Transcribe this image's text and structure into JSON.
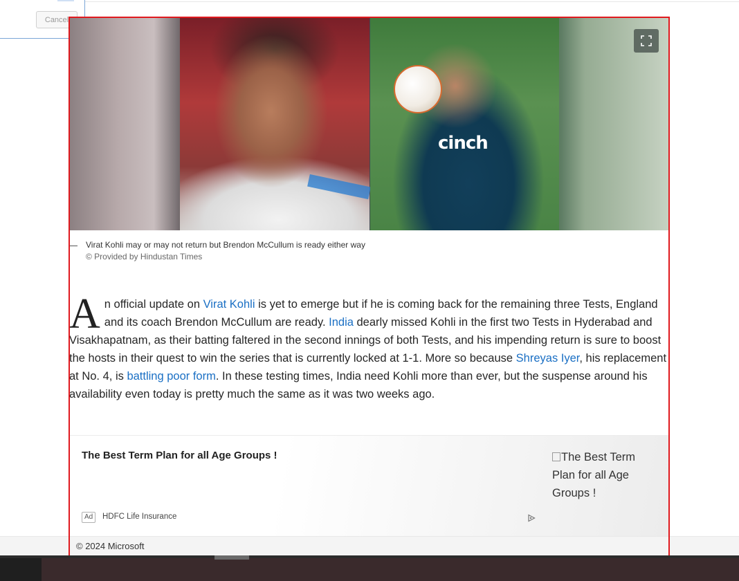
{
  "dialog": {
    "cancel_label": "Cancel"
  },
  "hero": {
    "left_person": "Virat Kohli",
    "right_person": "Brendon McCullum",
    "shirt_brand": "cinch",
    "expand_icon": "fullscreen-icon"
  },
  "caption": {
    "text": "Virat Kohli may or may not return but Brendon McCullum is ready either way",
    "provided_by": "© Provided by Hindustan Times"
  },
  "article": {
    "dropcap": "A",
    "s1": "n official update on ",
    "link_virat": "Virat Kohli",
    "s2": " is yet to emerge but if he is coming back for the remaining three Tests, England and its coach Brendon McCullum are ready. ",
    "link_india": "India",
    "s3": " dearly missed Kohli in the first two Tests in Hyderabad and Visakhapatnam, as their batting faltered in the second innings of both Tests, and his impending return is sure to boost the hosts in their quest to win the series that is currently locked at 1-1. More so because ",
    "link_shreyas": "Shreyas Iyer",
    "s4": ", his replacement at No. 4, is ",
    "link_form": "battling poor form",
    "s5": ". In these testing times, India need Kohli more than ever, but the suspense around his availability even today is pretty much the same as it was two weeks ago."
  },
  "ad": {
    "title": "The Best Term Plan for all Age Groups !",
    "image_alt": "The Best Term Plan for all Age Groups !",
    "badge": "Ad",
    "source": "HDFC Life Insurance"
  },
  "footer": {
    "copyright": "© 2024 Microsoft"
  },
  "colors": {
    "link": "#1a6fc4",
    "highlight_frame": "#e0191e"
  }
}
